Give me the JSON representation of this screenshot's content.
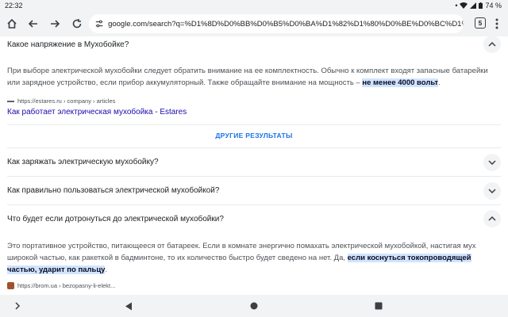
{
  "status": {
    "time": "22:32",
    "battery": "74 %"
  },
  "toolbar": {
    "url": "google.com/search?q=%D1%8D%D0%BB%D0%B5%D0%BA%D1%82%D1%80%D0%BE%D0%BC%D1%83%D1%85%D0%",
    "tab_count": "5"
  },
  "faq1": {
    "question": "Какое напряжение в Мухобойке?",
    "answer_before": "При выборе электрической мухобойки следует обратить внимание на ее комплектность. Обычно к комплект входят запасные батарейки или зарядное устройство, если прибор аккумуляторный. Также обращайте внимание на мощность – ",
    "answer_highlight": "не менее 4000 вольт",
    "answer_after": ".",
    "source": "https://estares.ru › company › articles",
    "link": "Как работает электрическая мухобойка - Estares"
  },
  "more_results": "ДРУГИЕ РЕЗУЛЬТАТЫ",
  "faq2": {
    "question": "Как заряжать электрическую мухобойку?"
  },
  "faq3": {
    "question": "Как правильно пользоваться электрической мухобойкой?"
  },
  "faq4": {
    "question": "Что будет если дотронуться до электрической мухобойки?",
    "answer_before": "Это портативное устройство, питающееся от батареек. Если в комнате энергично помахать электрической мухобойкой, настигая мух широкой частью, как ракеткой в бадминтоне, то их количество быстро будет сведено на нет. Да, ",
    "answer_highlight": "если коснуться токопроводящей частью, ударит по пальцу",
    "answer_after": ".",
    "source": "https://brom.ua › bezopasny-li-elekt..."
  }
}
